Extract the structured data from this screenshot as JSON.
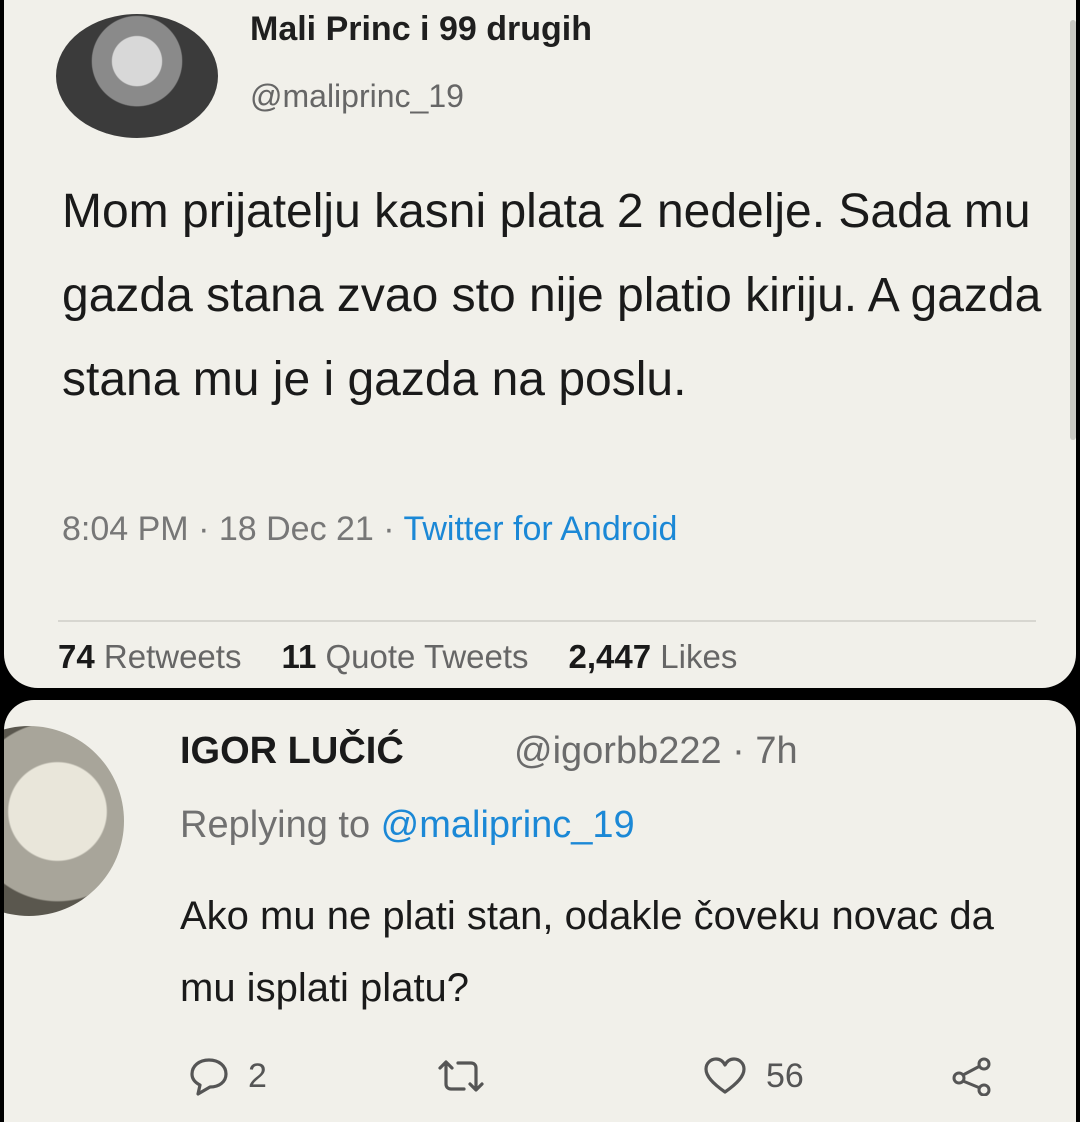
{
  "tweet": {
    "author_name": "Mali Princ i 99 drugih",
    "author_handle": "@maliprinc_19",
    "text": "Mom prijatelju kasni plata 2 nedelje. Sada mu gazda stana zvao sto nije platio kiriju. A gazda stana mu je i gazda na poslu.",
    "time": "8:04 PM · 18 Dec 21 · ",
    "source": "Twitter for Android",
    "stats": {
      "retweets_count": "74",
      "retweets_label": "Retweets",
      "quotes_count": "11",
      "quotes_label": "Quote Tweets",
      "likes_count": "2,447",
      "likes_label": "Likes"
    }
  },
  "reply": {
    "author_name": "IGOR LUČIĆ",
    "handle_time": "@igorbb222 · 7h",
    "replying_prefix": "Replying to ",
    "replying_mention": "@maliprinc_19",
    "text": "Ako mu ne plati stan, odakle čoveku novac da mu isplati platu?",
    "actions": {
      "reply_count": "2",
      "retweet_count": "",
      "like_count": "56"
    }
  },
  "icons": {
    "reply": "reply-bubble-icon",
    "retweet": "retweet-icon",
    "like": "heart-icon",
    "share": "share-icon"
  },
  "colors": {
    "card_background": "#f1f0ea",
    "link_blue": "#1b88d6",
    "page_background": "#000000"
  }
}
